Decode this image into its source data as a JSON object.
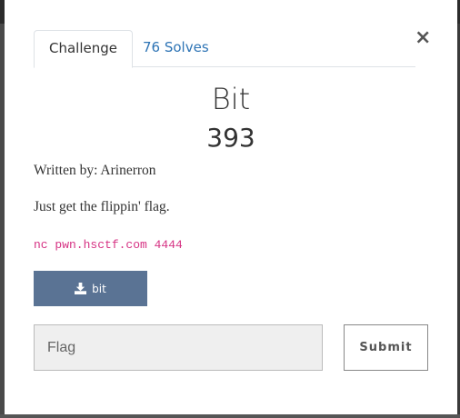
{
  "modal": {
    "close_label": "×",
    "tabs": [
      {
        "label": "Challenge"
      },
      {
        "label": "76 Solves"
      }
    ],
    "challenge": {
      "name": "Bit",
      "value": "393",
      "author": "Written by: Arinerron",
      "description": "Just get the flippin' flag.",
      "command": "nc pwn.hsctf.com 4444",
      "file_label": "bit"
    },
    "flag_input": {
      "placeholder": "Flag",
      "value": ""
    },
    "submit_label": "Submit"
  },
  "icons": {
    "download": "download-icon",
    "close": "close-icon"
  },
  "colors": {
    "accent": "#2e74b5",
    "file_button": "#5a7394",
    "code": "#d63384"
  }
}
